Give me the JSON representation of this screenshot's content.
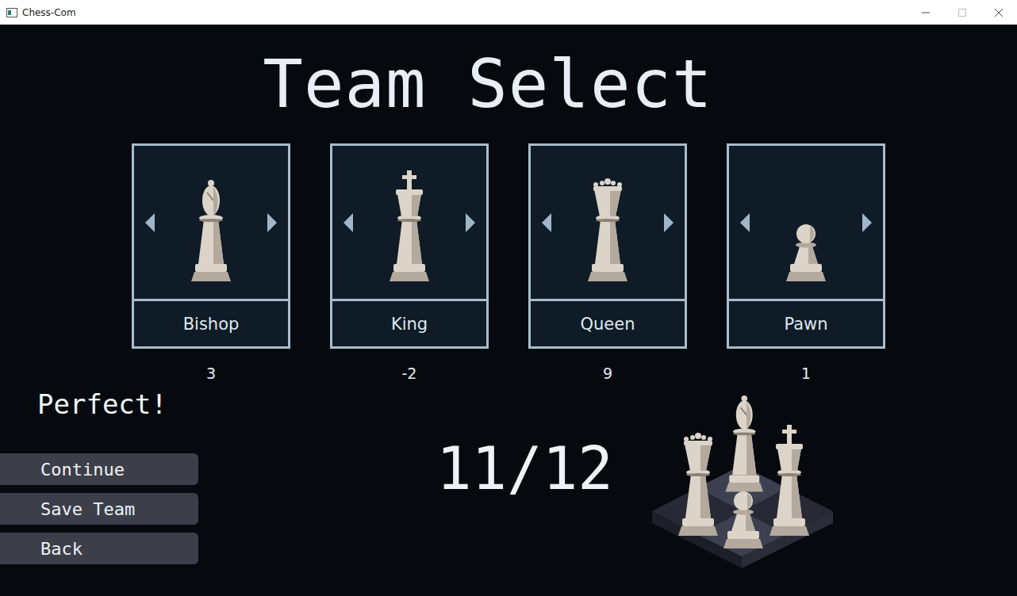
{
  "window": {
    "title": "Chess-Com"
  },
  "title": "Team Select",
  "cards": [
    {
      "name": "Bishop",
      "kind": "bishop",
      "value": "3"
    },
    {
      "name": "King",
      "kind": "king",
      "value": "-2"
    },
    {
      "name": "Queen",
      "kind": "queen",
      "value": "9"
    },
    {
      "name": "Pawn",
      "kind": "pawn",
      "value": "1"
    }
  ],
  "status": "Perfect!",
  "score": "11/12",
  "buttons": [
    "Continue",
    "Save Team",
    "Back"
  ]
}
